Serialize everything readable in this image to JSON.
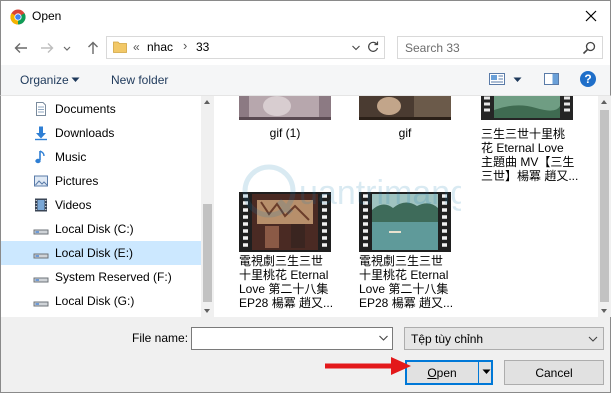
{
  "window": {
    "title": "Open"
  },
  "address": {
    "overflow": "«",
    "crumbs": [
      "nhac",
      "33"
    ]
  },
  "search": {
    "placeholder": "Search 33"
  },
  "toolbar": {
    "organize": "Organize",
    "new_folder": "New folder"
  },
  "sidebar": {
    "items": [
      {
        "label": "Documents",
        "icon": "documents-icon"
      },
      {
        "label": "Downloads",
        "icon": "downloads-icon"
      },
      {
        "label": "Music",
        "icon": "music-icon"
      },
      {
        "label": "Pictures",
        "icon": "pictures-icon"
      },
      {
        "label": "Videos",
        "icon": "videos-icon"
      },
      {
        "label": "Local Disk (C:)",
        "icon": "drive-icon"
      },
      {
        "label": "Local Disk (E:)",
        "icon": "drive-icon",
        "selected": true
      },
      {
        "label": "System Reserved (F:)",
        "icon": "drive-icon"
      },
      {
        "label": "Local Disk (G:)",
        "icon": "drive-icon"
      }
    ]
  },
  "files": [
    {
      "name": "gif (1)"
    },
    {
      "name": "gif"
    },
    {
      "name": "三生三世十里桃\n花 Eternal Love\n主題曲 MV【三生\n三世】楊冪 趙又..."
    },
    {
      "name": "電視劇三生三世\n十里桃花 Eternal\nLove 第二十八集\nEP28 楊冪 趙又..."
    },
    {
      "name": "電視劇三生三世\n十里桃花 Eternal\nLove 第二十八集\nEP28 楊冪 趙又..."
    }
  ],
  "bottom": {
    "file_name_label": "File name:",
    "file_name_value": "",
    "filter_value": "Tệp tùy chỉnh",
    "open_label": "Open",
    "cancel_label": "Cancel"
  },
  "watermark": {
    "text": "Quantrimang"
  },
  "colors": {
    "accent": "#0078d7",
    "selected_bg": "#cce8ff",
    "arrow_red": "#e3191b",
    "folder_yellow": "#f2c867"
  }
}
